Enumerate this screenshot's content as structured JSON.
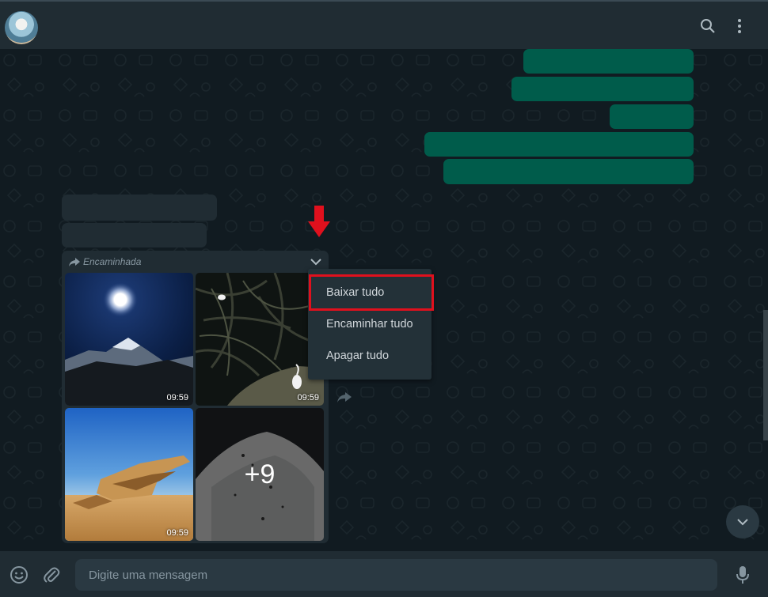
{
  "header": {
    "avatar_icon": "avatar",
    "search_icon": "search-icon",
    "menu_icon": "menu-icon"
  },
  "album": {
    "forwarded_label": "Encaminhada",
    "tiles": [
      {
        "duration": "09:59",
        "image": "moon-over-mountain"
      },
      {
        "duration": "09:59",
        "image": "egrets-in-palms"
      },
      {
        "duration": "09:59",
        "image": "desert-rocks"
      },
      {
        "more_count": "+9",
        "image": "sand-dune"
      }
    ]
  },
  "context_menu": {
    "items": [
      "Baixar tudo",
      "Encaminhar tudo",
      "Apagar tudo"
    ],
    "highlighted": "Baixar tudo"
  },
  "composer": {
    "placeholder": "Digite uma mensagem"
  },
  "colors": {
    "outgoing": "#005c4b",
    "incoming": "#202c33",
    "highlight": "#e0101d"
  }
}
